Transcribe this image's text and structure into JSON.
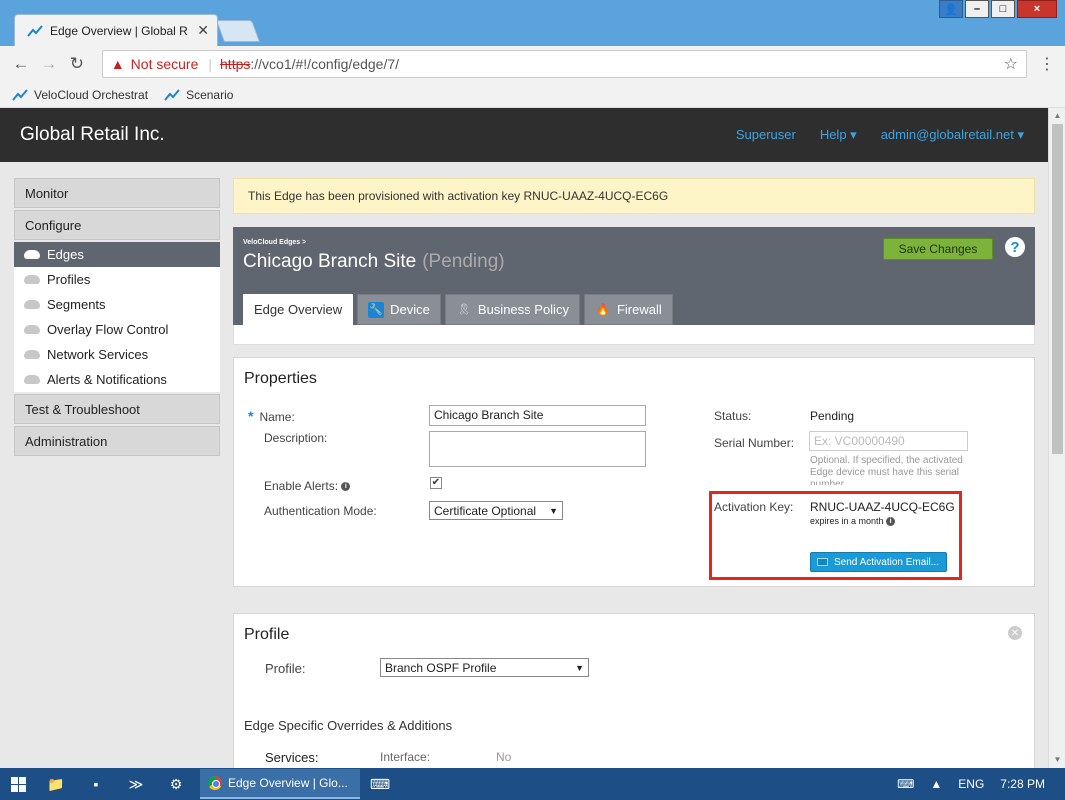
{
  "browser": {
    "tab_title": "Edge Overview | Global R",
    "omnibox": {
      "security_label": "Not secure",
      "scheme": "https",
      "url_rest": "://vco1/#!/config/edge/7/"
    },
    "bookmarks": [
      "VeloCloud Orchestrat",
      "Scenario"
    ],
    "window_controls": {
      "minimize": "–",
      "maximize": "□",
      "close": "×"
    }
  },
  "app": {
    "brand": "Global Retail Inc.",
    "nav": {
      "superuser": "Superuser",
      "help": "Help ▾",
      "account": "admin@globalretail.net ▾"
    }
  },
  "sidebar": {
    "monitor": "Monitor",
    "configure": "Configure",
    "items": [
      {
        "label": "Edges",
        "active": true
      },
      {
        "label": "Profiles"
      },
      {
        "label": "Segments"
      },
      {
        "label": "Overlay Flow Control"
      },
      {
        "label": "Network Services"
      },
      {
        "label": "Alerts & Notifications"
      }
    ],
    "test": "Test & Troubleshoot",
    "admin": "Administration"
  },
  "alert": "This Edge has been provisioned with activation key RNUC-UAAZ-4UCQ-EC6G",
  "edge": {
    "breadcrumb": "VeloCloud Edges >",
    "name": "Chicago Branch Site",
    "status_suffix": "(Pending)",
    "save": "Save Changes",
    "help": "?",
    "tabs": [
      "Edge Overview",
      "Device",
      "Business Policy",
      "Firewall"
    ]
  },
  "properties": {
    "heading": "Properties",
    "name_label": "Name:",
    "name_value": "Chicago Branch Site",
    "description_label": "Description:",
    "alerts_label": "Enable Alerts:",
    "alerts_checked": true,
    "auth_label": "Authentication Mode:",
    "auth_value": "Certificate Optional",
    "status_label": "Status:",
    "status_value": "Pending",
    "serial_label": "Serial Number:",
    "serial_placeholder": "Ex: VC00000490",
    "serial_hint": "Optional. If specified, the activated Edge device must have this serial number.",
    "activation_label": "Activation Key:",
    "activation_value": "RNUC-UAAZ-4UCQ-EC6G",
    "activation_expires": "expires in a month",
    "send_email": "Send Activation Email..."
  },
  "profile": {
    "heading": "Profile",
    "profile_label": "Profile:",
    "profile_value": "Branch OSPF Profile",
    "overrides_heading": "Edge Specific Overrides & Additions",
    "services_label": "Services:",
    "interface_label": "Interface:",
    "no_label": "No"
  },
  "taskbar": {
    "app_label": "Edge Overview | Glo...",
    "lang": "ENG",
    "time": "7:28 PM"
  },
  "colors": {
    "header_bg": "#2e2e2e",
    "accent": "#3ea3e0",
    "save_green": "#7db33a",
    "highlight_red": "#e5261c"
  }
}
